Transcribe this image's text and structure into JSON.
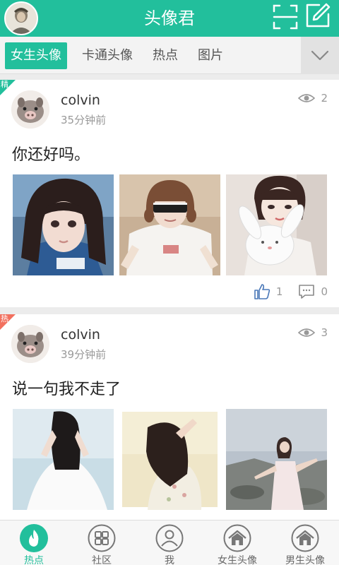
{
  "app": {
    "title": "头像君"
  },
  "tabs": [
    {
      "label": "女生头像",
      "active": true
    },
    {
      "label": "卡通头像",
      "active": false
    },
    {
      "label": "热点",
      "active": false
    },
    {
      "label": "图片",
      "active": false
    }
  ],
  "posts": [
    {
      "badge": "精",
      "badge_color": "#22bf9c",
      "user": "colvin",
      "time": "35分钟前",
      "views": "2",
      "title": "你还好吗。",
      "likes": "1",
      "comments": "0"
    },
    {
      "badge": "热",
      "badge_color": "#f2705e",
      "user": "colvin",
      "time": "39分钟前",
      "views": "3",
      "title": "说一句我不走了"
    }
  ],
  "nav": [
    {
      "label": "热点",
      "icon": "flame-icon",
      "active": true
    },
    {
      "label": "社区",
      "icon": "grid-icon",
      "active": false
    },
    {
      "label": "我",
      "icon": "person-icon",
      "active": false
    },
    {
      "label": "女生头像",
      "icon": "house-icon",
      "active": false
    },
    {
      "label": "男生头像",
      "icon": "house-icon",
      "active": false
    }
  ],
  "colors": {
    "accent": "#22bf9c",
    "hot": "#f2705e"
  }
}
